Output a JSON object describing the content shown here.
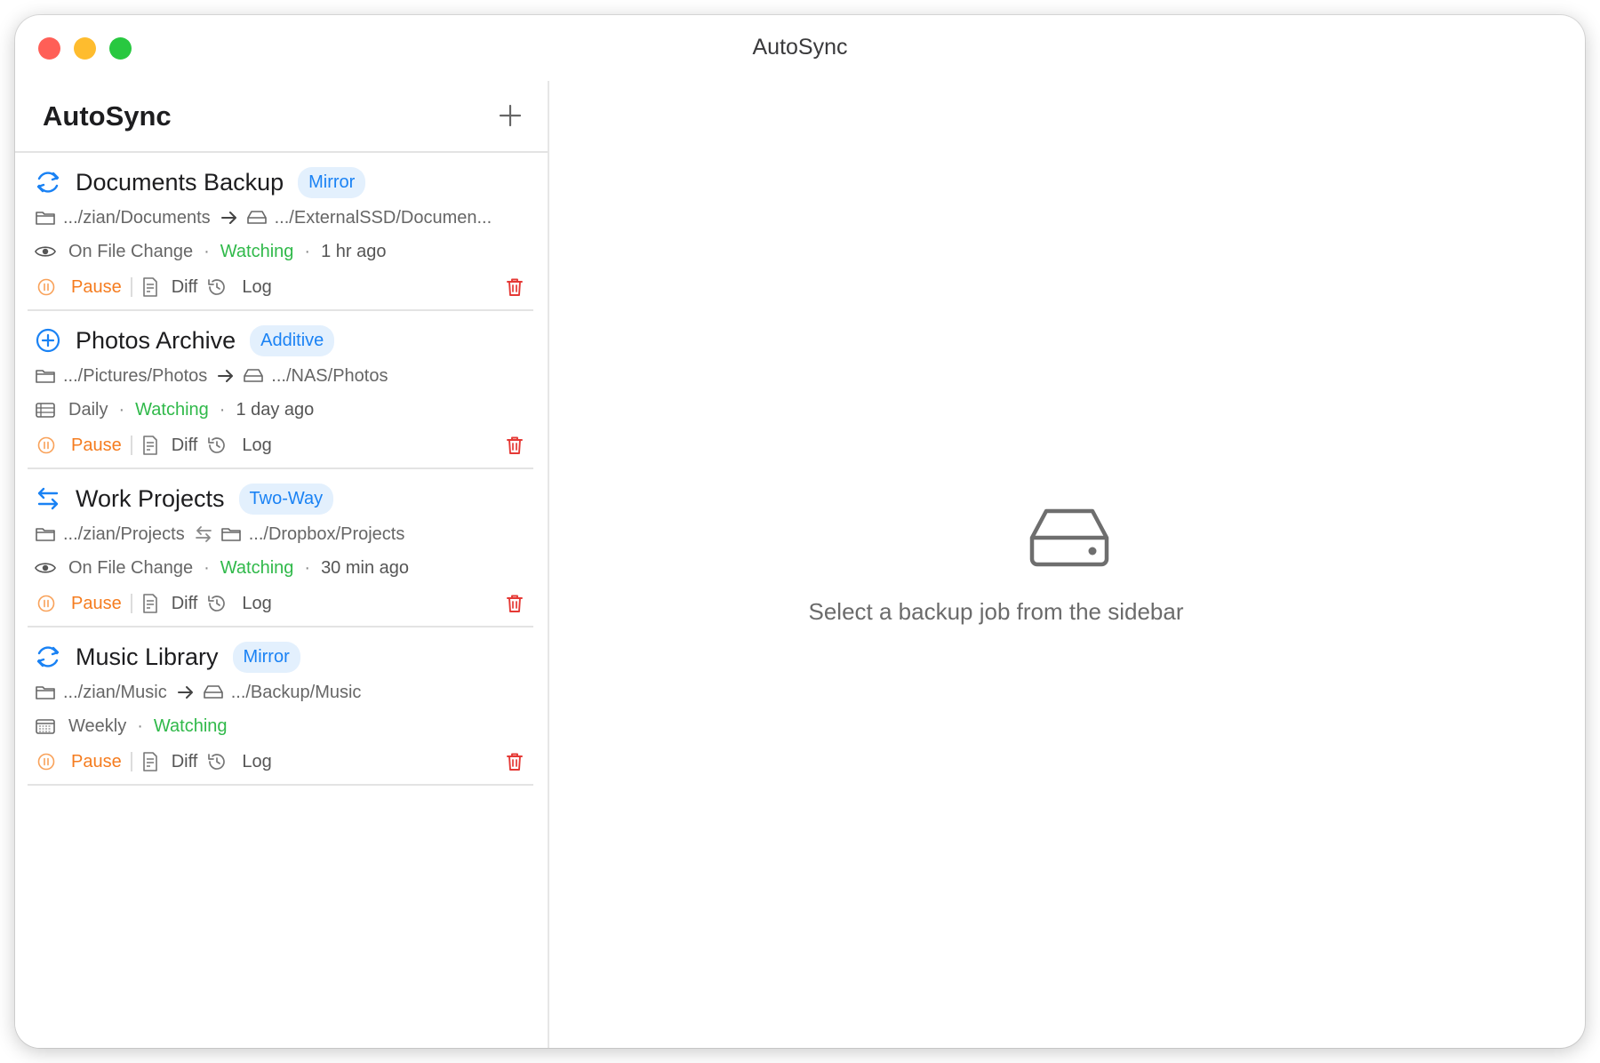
{
  "window": {
    "title": "AutoSync"
  },
  "sidebar": {
    "title": "AutoSync",
    "add_icon": "plus-icon",
    "jobs": [
      {
        "name": "Documents Backup",
        "mode": "Mirror",
        "icon": "sync-icon",
        "source": ".../zian/Documents",
        "dest": ".../ExternalSSD/Documen...",
        "dest_icon": "drive-icon",
        "direction": "arrow-right-icon",
        "trigger_icon": "eye-icon",
        "trigger": "On File Change",
        "status": "Watching",
        "last_run": "1 hr ago",
        "actions": {
          "pause": "Pause",
          "diff": "Diff",
          "log": "Log"
        }
      },
      {
        "name": "Photos Archive",
        "mode": "Additive",
        "icon": "plus-circle-icon",
        "source": ".../Pictures/Photos",
        "dest": ".../NAS/Photos",
        "dest_icon": "drive-icon",
        "direction": "arrow-right-icon",
        "trigger_icon": "calendar-list-icon",
        "trigger": "Daily",
        "status": "Watching",
        "last_run": "1 day ago",
        "actions": {
          "pause": "Pause",
          "diff": "Diff",
          "log": "Log"
        }
      },
      {
        "name": "Work Projects",
        "mode": "Two-Way",
        "icon": "two-way-arrows-icon",
        "source": ".../zian/Projects",
        "dest": ".../Dropbox/Projects",
        "dest_icon": "folder-icon",
        "direction": "two-way-arrows-icon",
        "trigger_icon": "eye-icon",
        "trigger": "On File Change",
        "status": "Watching",
        "last_run": "30 min ago",
        "actions": {
          "pause": "Pause",
          "diff": "Diff",
          "log": "Log"
        }
      },
      {
        "name": "Music Library",
        "mode": "Mirror",
        "icon": "sync-icon",
        "source": ".../zian/Music",
        "dest": ".../Backup/Music",
        "dest_icon": "drive-icon",
        "direction": "arrow-right-icon",
        "trigger_icon": "calendar-grid-icon",
        "trigger": "Weekly",
        "status": "Watching",
        "last_run": "",
        "actions": {
          "pause": "Pause",
          "diff": "Diff",
          "log": "Log"
        }
      }
    ]
  },
  "main": {
    "empty_icon": "drive-icon",
    "empty_message": "Select a backup job from the sidebar"
  },
  "colors": {
    "accent_blue": "#1a82f4",
    "badge_bg": "#e3f0fd",
    "watching_green": "#30b94a",
    "pause_orange": "#f57c1f",
    "delete_red": "#e53935"
  }
}
